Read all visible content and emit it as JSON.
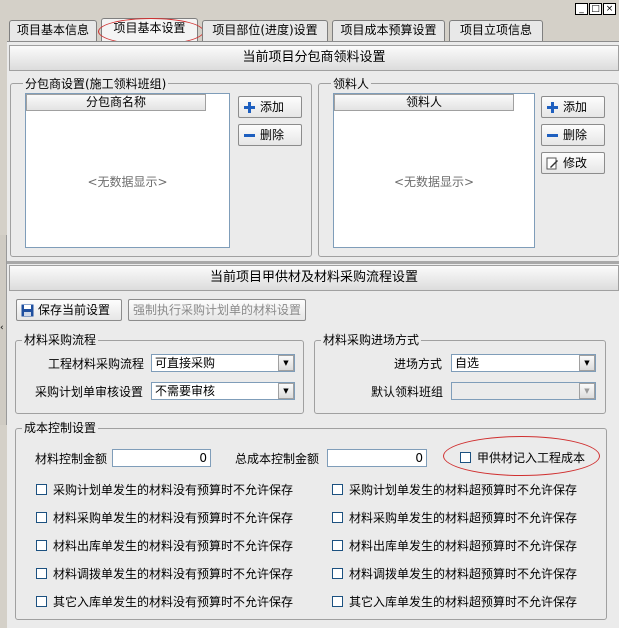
{
  "window": {
    "minimize": "_",
    "maximize": "□",
    "close": "×"
  },
  "tabs": [
    {
      "label": "项目基本信息"
    },
    {
      "label": "项目基本设置"
    },
    {
      "label": "项目部位(进度)设置"
    },
    {
      "label": "项目成本预算设置"
    },
    {
      "label": "项目立项信息"
    }
  ],
  "subcontract": {
    "title": "当前项目分包商领料设置",
    "left_group": "分包商设置(施工领料班组)",
    "left_column": "分包商名称",
    "left_empty": "<无数据显示>",
    "right_group": "领料人",
    "right_column": "领料人",
    "right_empty": "<无数据显示>",
    "add_label": "添加",
    "delete_label": "删除",
    "edit_label": "修改"
  },
  "procurement": {
    "title": "当前项目甲供材及材料采购流程设置",
    "save_label": "保存当前设置",
    "force_label": "强制执行采购计划单的材料设置",
    "flow_group": "材料采购流程",
    "flow_label": "工程材料采购流程",
    "flow_value": "可直接采购",
    "audit_label": "采购计划单审核设置",
    "audit_value": "不需要审核",
    "entry_group": "材料采购进场方式",
    "entry_label": "进场方式",
    "entry_value": "自选",
    "team_label": "默认领料班组",
    "team_value": ""
  },
  "cost": {
    "group": "成本控制设置",
    "material_amount_label": "材料控制金额",
    "material_amount_value": "0",
    "total_amount_label": "总成本控制金额",
    "total_amount_value": "0",
    "supplied_cost_label": "甲供材记入工程成本",
    "left_checks": [
      "采购计划单发生的材料没有预算时不允许保存",
      "材料采购单发生的材料没有预算时不允许保存",
      "材料出库单发生的材料没有预算时不允许保存",
      "材料调拨单发生的材料没有预算时不允许保存",
      "其它入库单发生的材料没有预算时不允许保存"
    ],
    "right_checks": [
      "采购计划单发生的材料超预算时不允许保存",
      "材料采购单发生的材料超预算时不允许保存",
      "材料出库单发生的材料超预算时不允许保存",
      "材料调拨单发生的材料超预算时不允许保存",
      "其它入库单发生的材料超预算时不允许保存"
    ]
  },
  "colors": {
    "accent_blue": "#1e5fbf",
    "annotation_red": "#d03030",
    "panel": "#ebebeb"
  }
}
